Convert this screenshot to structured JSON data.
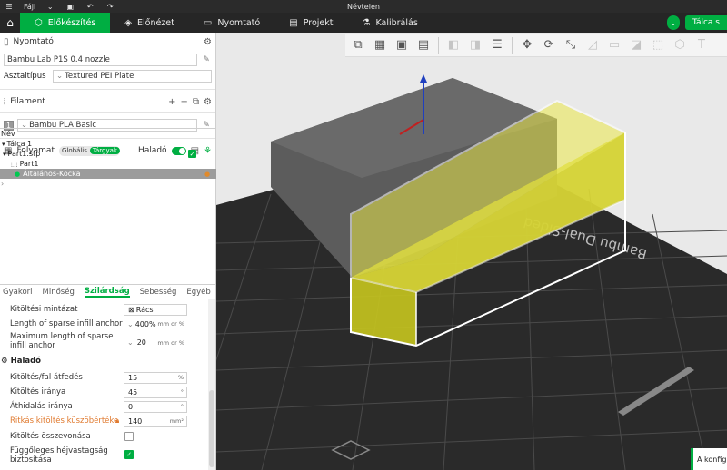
{
  "titlebar": {
    "menu_file": "Fájl",
    "doc_title": "Névtelen"
  },
  "tabs": [
    {
      "label": "Előkészítés",
      "active": true
    },
    {
      "label": "Előnézet"
    },
    {
      "label": "Nyomtató"
    },
    {
      "label": "Projekt"
    },
    {
      "label": "Kalibrálás"
    }
  ],
  "slice_button": "Tálca s",
  "printer": {
    "heading": "Nyomtató",
    "model": "Bambu Lab P1S 0.4 nozzle",
    "plate_label": "Asztaltípus",
    "plate_value": "Textured PEI Plate"
  },
  "filament": {
    "heading": "Filament",
    "slot": "1",
    "name": "Bambu PLA Basic"
  },
  "process": {
    "heading": "Folyamat",
    "scope_global": "Globális",
    "scope_objects": "Tárgyak",
    "advanced_label": "Haladó"
  },
  "tree": {
    "header": "Név",
    "plate": "Tálca 1",
    "file": "Part1.stp",
    "part": "Part1",
    "modifier": "Általános-Kocka"
  },
  "param_tabs": [
    "Gyakori",
    "Minőség",
    "Szilárdság",
    "Sebesség",
    "Egyéb"
  ],
  "params": {
    "infill_pattern_label": "Kitöltési mintázat",
    "infill_pattern_value": "Rács",
    "anchor_label": "Length of sparse infill anchor",
    "anchor_value": "400%",
    "anchor_unit": "mm or %",
    "anchor_max_label_1": "Maximum length of sparse",
    "anchor_max_label_2": "infill anchor",
    "anchor_max_value": "20",
    "anchor_max_unit": "mm or %",
    "advanced_heading": "Haladó",
    "overlap_label": "Kitöltés/fal átfedés",
    "overlap_value": "15",
    "overlap_unit": "%",
    "direction_label": "Kitöltés iránya",
    "direction_value": "45",
    "direction_unit": "°",
    "bridge_label": "Áthidalás iránya",
    "bridge_value": "0",
    "bridge_unit": "°",
    "threshold_label": "Ritkás kitöltés küszöbértéke",
    "threshold_value": "140",
    "threshold_unit": "mm²",
    "combination_label": "Kitöltés összevonása",
    "ensure_label_1": "Függőleges héjvastagság",
    "ensure_label_2": "biztosítása"
  },
  "plate_text": "Bambu Dual-Sided",
  "toast": "A konfigur"
}
